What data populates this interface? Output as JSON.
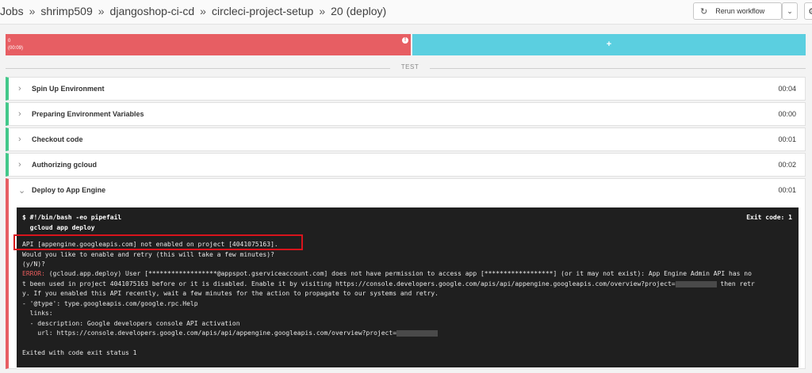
{
  "breadcrumb": {
    "items": [
      "Jobs",
      "shrimp509",
      "djangoshop-ci-cd",
      "circleci-project-setup",
      "20 (deploy)"
    ],
    "separator": "»"
  },
  "toolbar": {
    "rerun_label": "Rerun workflow",
    "rerun_icon": "refresh-icon",
    "dropdown_icon": "chevron-down-icon",
    "settings_icon": "gear-icon"
  },
  "timeline": {
    "failed_container": {
      "index": "0",
      "time": "(00:09)",
      "status_icon": "alert-icon",
      "color": "#e75e63"
    },
    "add_label": "+",
    "add_color": "#5bcfe0"
  },
  "section_label": "TEST",
  "steps": [
    {
      "name": "Spin Up Environment",
      "duration": "00:04",
      "status": "success"
    },
    {
      "name": "Preparing Environment Variables",
      "duration": "00:00",
      "status": "success"
    },
    {
      "name": "Checkout code",
      "duration": "00:01",
      "status": "success"
    },
    {
      "name": "Authorizing gcloud",
      "duration": "00:02",
      "status": "success"
    },
    {
      "name": "Deploy to App Engine",
      "duration": "00:01",
      "status": "failed"
    }
  ],
  "colors": {
    "success": "#42c88a",
    "failed": "#e75e63",
    "terminal_bg": "#1f1f1f",
    "highlight": "#d8141c"
  },
  "terminal": {
    "cmd_line1": "$ #!/bin/bash -eo pipefail",
    "cmd_line2": "  gcloud app deploy",
    "exit_code": "Exit code: 1",
    "out1": "API [appengine.googleapis.com] not enabled on project [4041075163].",
    "out2": "Would you like to enable and retry (this will take a few minutes)?",
    "out3": "(y/N)?",
    "error_label": "ERROR:",
    "out4_rest": " (gcloud.app.deploy) User [******************@appspot.gserviceaccount.com] does not have permission to access app [******************] (or it may not exist): App Engine Admin API has no",
    "out5_pre": "t been used in project 4041075163 before or it is disabled. Enable it by visiting https://console.developers.google.com/apis/api/appengine.googleapis.com/overview?project=",
    "out5_post": " then retr",
    "out6": "y. If you enabled this API recently, wait a few minutes for the action to propagate to our systems and retry.",
    "out7": "- '@type': type.googleapis.com/google.rpc.Help",
    "out8": "  links:",
    "out9": "  - description: Google developers console API activation",
    "out10_pre": "    url: https://console.developers.google.com/apis/api/appengine.googleapis.com/overview?project=",
    "out11": "Exited with code exit status 1"
  }
}
